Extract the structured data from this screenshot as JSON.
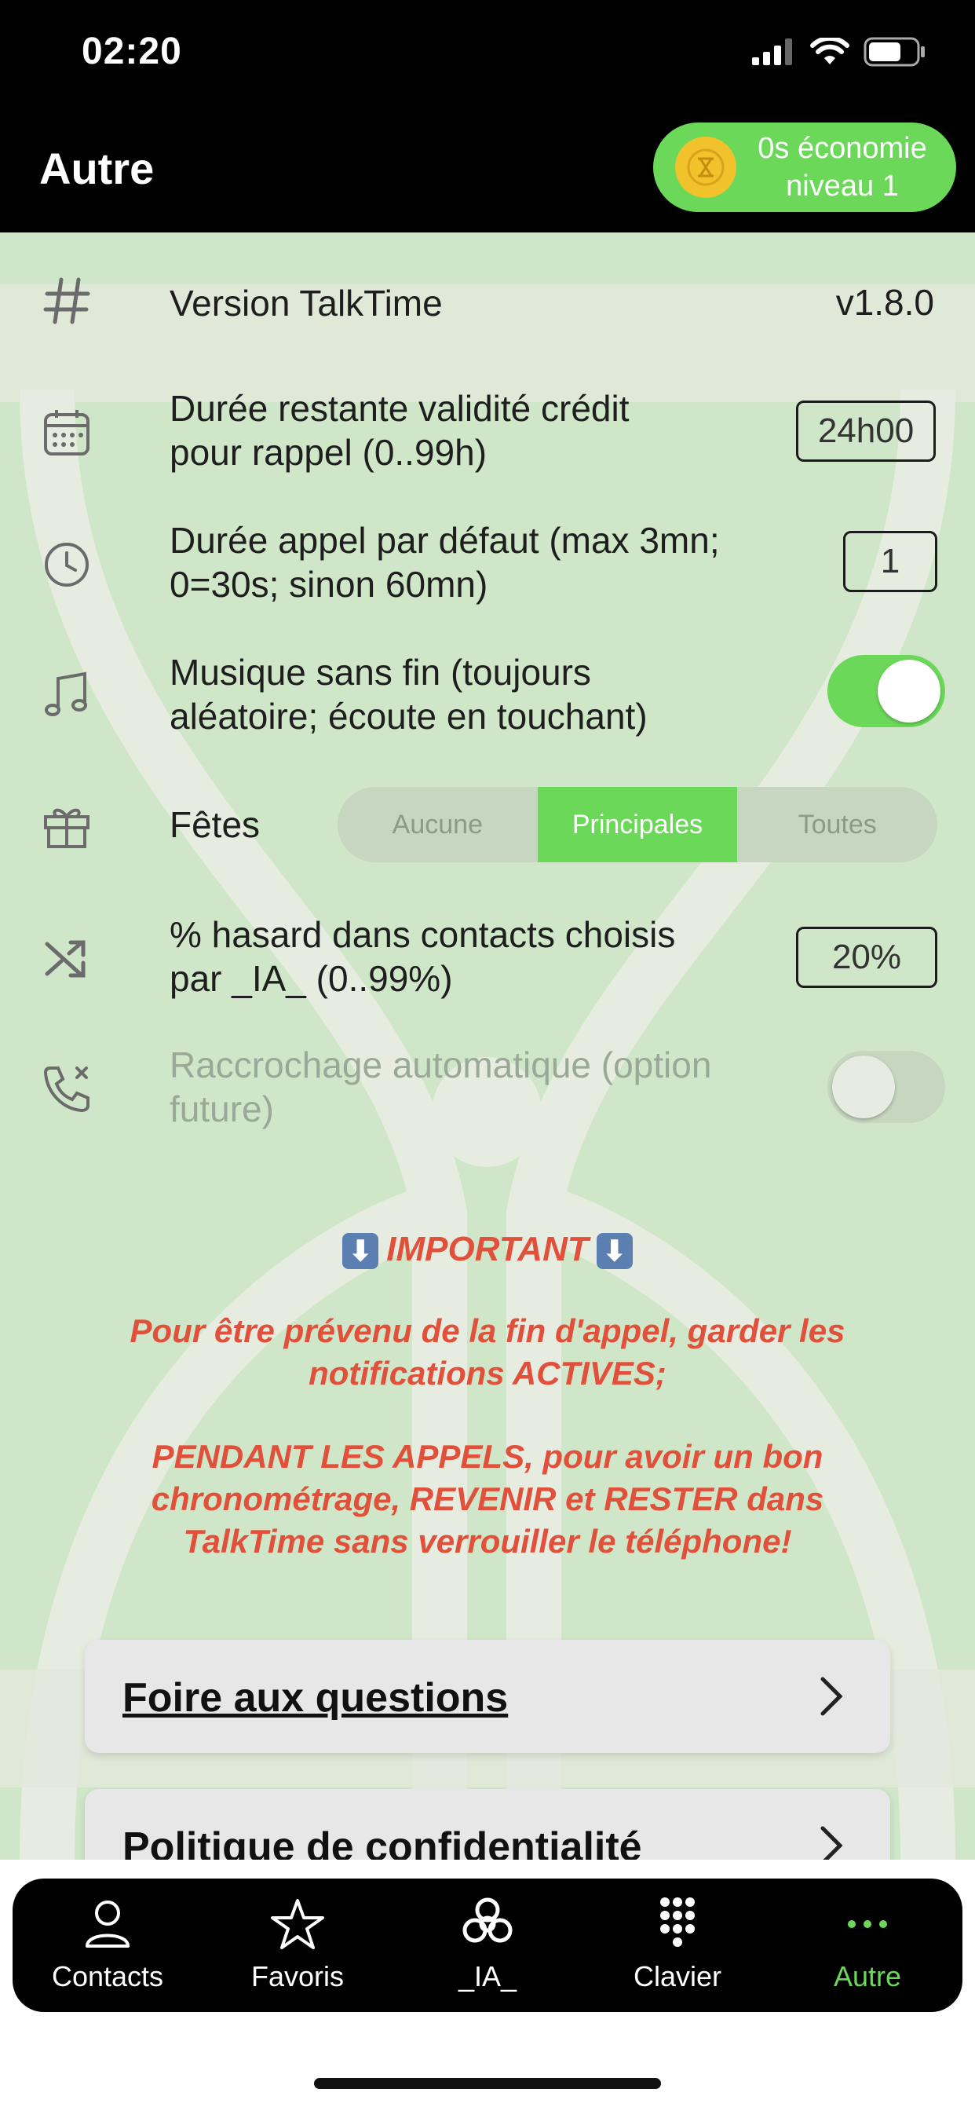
{
  "status": {
    "time": "02:20"
  },
  "header": {
    "title": "Autre",
    "economy_line1": "0s économie",
    "economy_line2": "niveau 1"
  },
  "settings": {
    "version": {
      "label": "Version TalkTime",
      "value": "v1.8.0",
      "icon": "hash-icon"
    },
    "credit": {
      "label_line1": "Durée restante validité crédit",
      "label_line2": "pour rappel (0..99h)",
      "value": "24h00",
      "icon": "calendar-icon"
    },
    "call_duration": {
      "label_line1": "Durée appel par défaut (max 3mn;",
      "label_line2": "0=30s; sinon 60mn)",
      "value": "1",
      "icon": "clock-icon"
    },
    "music": {
      "label_line1": "Musique sans fin (toujours",
      "label_line2": "aléatoire; écoute en touchant)",
      "enabled": true,
      "icon": "music-note-icon"
    },
    "holidays": {
      "label": "Fêtes",
      "options": [
        "Aucune",
        "Principales",
        "Toutes"
      ],
      "selected": "Principales",
      "icon": "gift-icon"
    },
    "random": {
      "label_line1": "% hasard dans contacts choisis",
      "label_line2": "par _IA_ (0..99%)",
      "value": "20%",
      "icon": "shuffle-icon"
    },
    "auto_hangup": {
      "label_line1": "Raccrochage automatique (option",
      "label_line2": "future)",
      "enabled": false,
      "icon": "phone-x-icon"
    }
  },
  "important": {
    "title": "IMPORTANT",
    "para1_line1": "Pour être prévenu de la fin d'appel, garder les",
    "para1_line2": "notifications ACTIVES;",
    "para2_line1": "PENDANT LES APPELS, pour avoir un bon",
    "para2_line2": "chronométrage, REVENIR et RESTER dans",
    "para2_line3": "TalkTime sans verrouiller le téléphone!"
  },
  "links": {
    "faq": "Foire aux questions",
    "privacy": "Politique de confidentialité"
  },
  "tabs": [
    {
      "label": "Contacts",
      "icon": "person-icon"
    },
    {
      "label": "Favoris",
      "icon": "star-icon"
    },
    {
      "label": "_IA_",
      "icon": "ai-knot-icon"
    },
    {
      "label": "Clavier",
      "icon": "keypad-icon"
    },
    {
      "label": "Autre",
      "icon": "more-icon",
      "active": true
    }
  ],
  "colors": {
    "accent": "#6cd85a",
    "warning": "#e0503a",
    "background": "#cfe7c8"
  }
}
